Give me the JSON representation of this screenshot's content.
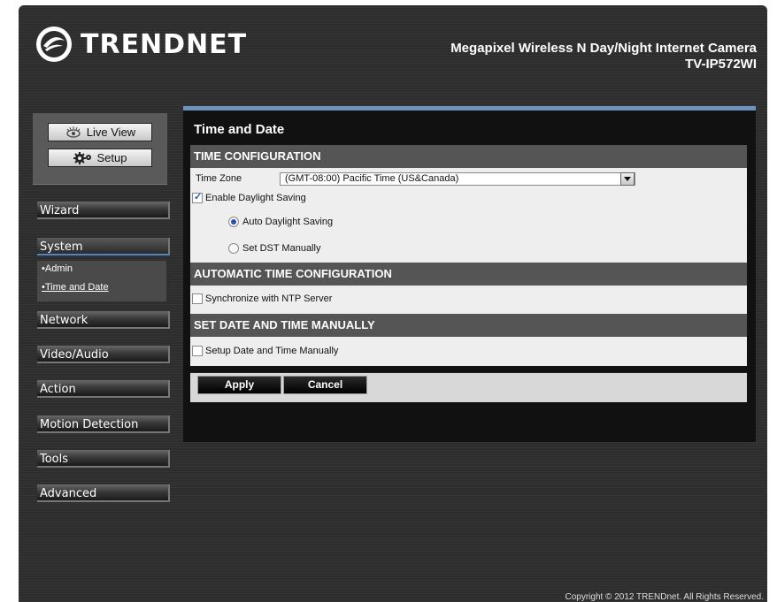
{
  "header": {
    "brand": "TRENDNET",
    "product_name": "Megapixel Wireless N Day/Night Internet Camera",
    "model": "TV-IP572WI"
  },
  "view_buttons": {
    "live_view": "Live View",
    "setup": "Setup"
  },
  "nav": {
    "wizard": "Wizard",
    "system": "System",
    "system_sub": [
      "•Admin",
      "•Time and Date"
    ],
    "network": "Network",
    "video_audio": "Video/Audio",
    "action": "Action",
    "motion_detection": "Motion Detection",
    "tools": "Tools",
    "advanced": "Advanced"
  },
  "panel": {
    "title": "Time and Date",
    "time_config": {
      "heading": "TIME CONFIGURATION",
      "time_zone_label": "Time Zone",
      "time_zone_value": "(GMT-08:00) Pacific Time (US&Canada)",
      "enable_dst_label": "Enable Daylight Saving",
      "enable_dst_checked": true,
      "auto_dst_label": "Auto Daylight Saving",
      "manual_dst_label": "Set DST Manually",
      "selected_dst_mode": "auto"
    },
    "auto_time": {
      "heading": "AUTOMATIC TIME CONFIGURATION",
      "ntp_label": "Synchronize with NTP Server",
      "ntp_checked": false
    },
    "manual_time": {
      "heading": "SET DATE AND TIME MANUALLY",
      "manual_label": "Setup Date and Time Manually",
      "manual_checked": false
    },
    "apply_label": "Apply",
    "cancel_label": "Cancel"
  },
  "footer": {
    "copyright": "Copyright © 2012 TRENDnet. All Rights Reserved."
  },
  "colors": {
    "accent_blue": "#6d92c0",
    "section_header": "#555555",
    "background": "#2d2d2d"
  }
}
